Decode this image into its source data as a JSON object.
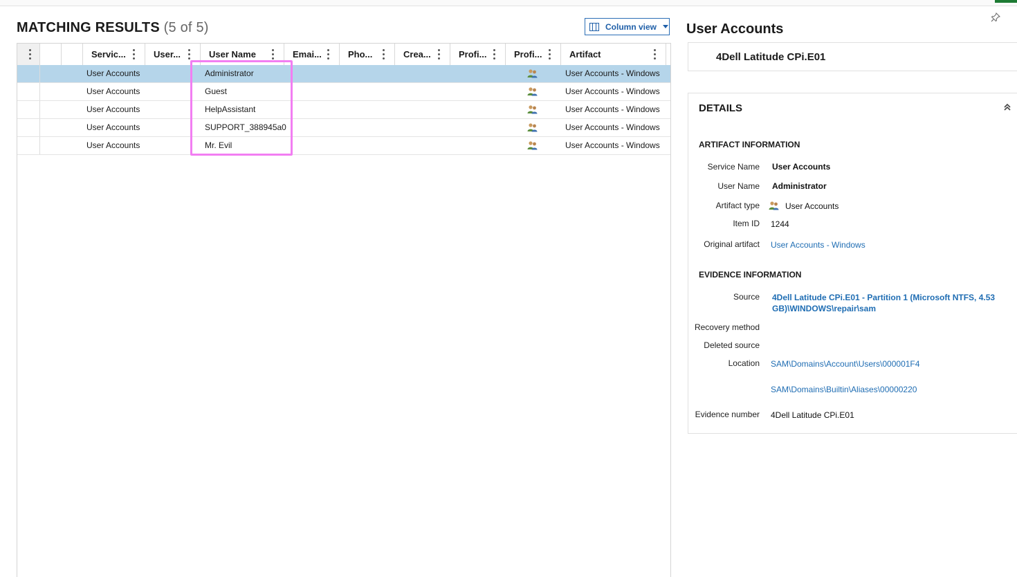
{
  "results": {
    "title": "MATCHING RESULTS",
    "count": "(5 of 5)",
    "column_view_label": "Column view"
  },
  "columns": [
    "Servic...",
    "User...",
    "User Name",
    "Emai...",
    "Pho...",
    "Crea...",
    "Profi...",
    "Profi...",
    "Artifact"
  ],
  "rows": [
    {
      "service": "User Accounts",
      "user_name": "Administrator",
      "profile_icon": "user-accounts-icon",
      "artifact": "User Accounts - Windows",
      "selected": true
    },
    {
      "service": "User Accounts",
      "user_name": "Guest",
      "profile_icon": "user-accounts-icon",
      "artifact": "User Accounts - Windows",
      "selected": false
    },
    {
      "service": "User Accounts",
      "user_name": "HelpAssistant",
      "profile_icon": "user-accounts-icon",
      "artifact": "User Accounts - Windows",
      "selected": false
    },
    {
      "service": "User Accounts",
      "user_name": "SUPPORT_388945a0",
      "profile_icon": "user-accounts-icon",
      "artifact": "User Accounts - Windows",
      "selected": false
    },
    {
      "service": "User Accounts",
      "user_name": "Mr. Evil",
      "profile_icon": "user-accounts-icon",
      "artifact": "User Accounts - Windows",
      "selected": false
    }
  ],
  "detail_pane": {
    "title": "User Accounts",
    "evidence_name": "4Dell Latitude CPi.E01",
    "details_title": "DETAILS",
    "artifact_info": {
      "title": "ARTIFACT INFORMATION",
      "service_name_label": "Service Name",
      "service_name": "User Accounts",
      "user_name_label": "User Name",
      "user_name": "Administrator",
      "artifact_type_label": "Artifact type",
      "artifact_type": "User Accounts",
      "item_id_label": "Item ID",
      "item_id": "1244",
      "original_artifact_label": "Original artifact",
      "original_artifact": "User Accounts - Windows"
    },
    "evidence_info": {
      "title": "EVIDENCE INFORMATION",
      "source_label": "Source",
      "source": "4Dell Latitude CPi.E01 - Partition 1 (Microsoft NTFS, 4.53 GB)\\WINDOWS\\repair\\sam",
      "recovery_method_label": "Recovery method",
      "deleted_source_label": "Deleted source",
      "location_label": "Location",
      "location_1": "SAM\\Domains\\Account\\Users\\000001F4",
      "location_2": "SAM\\Domains\\Builtin\\Aliases\\00000220",
      "evidence_number_label": "Evidence number",
      "evidence_number": "4Dell Latitude CPi.E01"
    }
  },
  "colors": {
    "accent": "#1f6db3",
    "selected_row": "#b5d5ea",
    "highlight_box": "#f27ef2"
  }
}
